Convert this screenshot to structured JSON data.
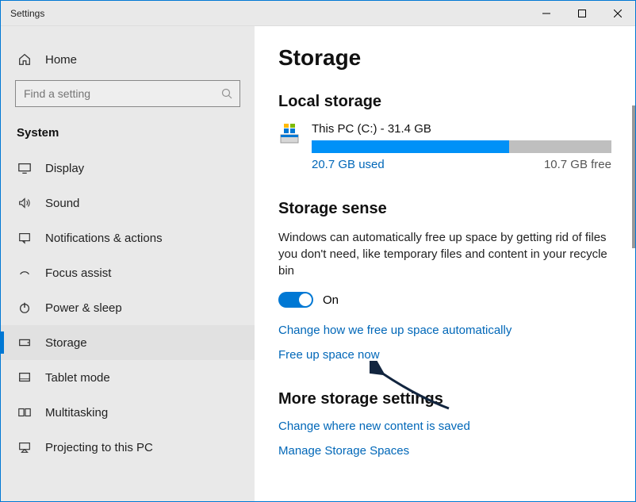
{
  "window": {
    "title": "Settings"
  },
  "sidebar": {
    "home": "Home",
    "search_placeholder": "Find a setting",
    "category": "System",
    "items": [
      {
        "label": "Display"
      },
      {
        "label": "Sound"
      },
      {
        "label": "Notifications & actions"
      },
      {
        "label": "Focus assist"
      },
      {
        "label": "Power & sleep"
      },
      {
        "label": "Storage"
      },
      {
        "label": "Tablet mode"
      },
      {
        "label": "Multitasking"
      },
      {
        "label": "Projecting to this PC"
      }
    ],
    "active_index": 5
  },
  "main": {
    "title": "Storage",
    "local_heading": "Local storage",
    "disk": {
      "title": "This PC (C:) - 31.4 GB",
      "used_label": "20.7 GB used",
      "free_label": "10.7 GB free",
      "fill_percent": 66
    },
    "sense": {
      "heading": "Storage sense",
      "body": "Windows can automatically free up space by getting rid of files you don't need, like temporary files and content in your recycle bin",
      "toggle_state": "On",
      "link_change": "Change how we free up space automatically",
      "link_free": "Free up space now"
    },
    "more": {
      "heading": "More storage settings",
      "link_where": "Change where new content is saved",
      "link_spaces": "Manage Storage Spaces"
    }
  }
}
